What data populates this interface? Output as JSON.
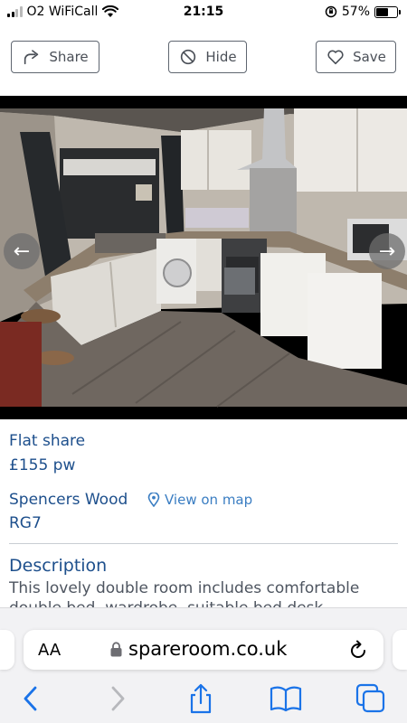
{
  "status_bar": {
    "carrier": "O2 WiFiCall",
    "time": "21:15",
    "battery_percent": "57%",
    "battery_level": 0.57
  },
  "actions": {
    "share_label": "Share",
    "hide_label": "Hide",
    "save_label": "Save"
  },
  "listing": {
    "type": "Flat share",
    "price": "£155 pw",
    "area": "Spencers Wood",
    "map_link": "View on map",
    "postcode": "RG7",
    "description_heading": "Description",
    "description_line1": "This lovely double room includes comfortable",
    "description_line2": "double bed, wardrobe, suitable bed desk"
  },
  "browser": {
    "text_size_label": "AA",
    "url": "spareroom.co.uk"
  },
  "colors": {
    "link_blue": "#1d4f8c",
    "accent_blue": "#3a7dc2",
    "toolbar_blue": "#1a73e8"
  }
}
